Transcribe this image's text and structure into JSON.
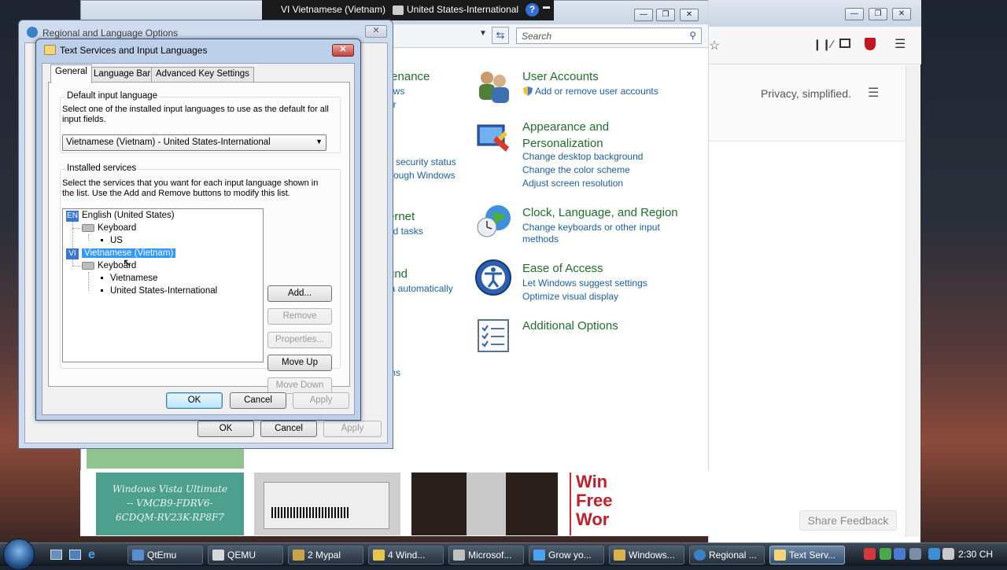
{
  "langbar": {
    "language": "VI Vietnamese (Vietnam)",
    "keyboard": "United States-International",
    "help": "?"
  },
  "firefox": {
    "search_placeholder": "Search",
    "privacy_text": "Privacy, simplified.",
    "share_feedback": "Share Feedback"
  },
  "control_panel": {
    "left_partial": [
      "tenance",
      "ows",
      "er",
      "security status",
      "rough Windows",
      "ernet",
      "nd tasks",
      "und",
      "ia automatically",
      "ms"
    ],
    "categories": [
      {
        "title": "User Accounts",
        "links": [
          "Add or remove user accounts"
        ]
      },
      {
        "title": "Appearance and Personalization",
        "links": [
          "Change desktop background",
          "Change the color scheme",
          "Adjust screen resolution"
        ]
      },
      {
        "title": "Clock, Language, and Region",
        "links": [
          "Change keyboards or other input methods"
        ]
      },
      {
        "title": "Ease of Access",
        "links": [
          "Let Windows suggest settings",
          "Optimize visual display"
        ]
      },
      {
        "title": "Additional Options",
        "links": []
      }
    ]
  },
  "thumbnails": {
    "vista_key": [
      "Windows Vista Ultimate",
      "-- VMCB9-FDRV6-",
      "6CDQM-RV23K-RP8F7"
    ],
    "partial": [
      "Win",
      "Free",
      "Wor"
    ]
  },
  "regional_dialog": {
    "title": "Regional and Language Options",
    "ok": "OK",
    "cancel": "Cancel",
    "apply": "Apply"
  },
  "text_services": {
    "title": "Text Services and Input Languages",
    "tabs": [
      "General",
      "Language Bar",
      "Advanced Key Settings"
    ],
    "default_group_label": "Default input language",
    "default_desc": "Select one of the installed input languages to use as the default for all input fields.",
    "default_value": "Vietnamese (Vietnam) - United States-International",
    "installed_group_label": "Installed services",
    "installed_desc": "Select the services that you want for each input language shown in the list. Use the Add and Remove buttons to modify this list.",
    "tree": {
      "lang1_badge": "EN",
      "lang1": "English (United States)",
      "lang1_kb": "Keyboard",
      "lang1_kb_item": "US",
      "lang2_badge": "VI",
      "lang2": "Vietnamese (Vietnam)",
      "lang2_kb": "Keyboard",
      "lang2_kb_items": [
        "Vietnamese",
        "United States-International"
      ]
    },
    "buttons": {
      "add": "Add...",
      "remove": "Remove",
      "properties": "Properties...",
      "move_up": "Move Up",
      "move_down": "Move Down",
      "ok": "OK",
      "cancel": "Cancel",
      "apply": "Apply"
    }
  },
  "taskbar": {
    "items": [
      "QtEmu",
      "QEMU",
      "2 Mypal",
      "4 Wind...",
      "Microsof...",
      "Grow yo...",
      "Windows...",
      "Regional ...",
      "Text Serv..."
    ],
    "clock": "2:30 CH"
  }
}
